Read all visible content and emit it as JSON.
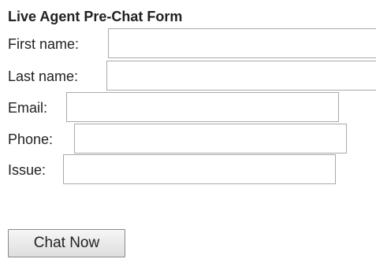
{
  "form": {
    "title": "Live Agent Pre-Chat Form",
    "fields": {
      "first_name": {
        "label": "First name:",
        "value": ""
      },
      "last_name": {
        "label": "Last name:",
        "value": ""
      },
      "email": {
        "label": "Email:",
        "value": ""
      },
      "phone": {
        "label": "Phone:",
        "value": ""
      },
      "issue": {
        "label": "Issue:",
        "value": ""
      }
    },
    "submit_label": "Chat Now"
  }
}
